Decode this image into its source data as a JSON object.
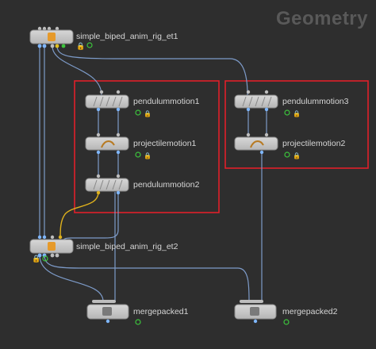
{
  "network_context": "Geometry",
  "nodes": {
    "rig_et1": {
      "name": "simple_biped_anim_rig_et1"
    },
    "pendulummotion1": {
      "name": "pendulummotion1"
    },
    "projectilemotion1": {
      "name": "projectilemotion1"
    },
    "pendulummotion2": {
      "name": "pendulummotion2"
    },
    "pendulummotion3": {
      "name": "pendulummotion3"
    },
    "projectilemotion2": {
      "name": "projectilemotion2"
    },
    "rig_et2": {
      "name": "simple_biped_anim_rig_et2"
    },
    "mergepacked1": {
      "name": "mergepacked1"
    },
    "mergepacked2": {
      "name": "mergepacked2"
    }
  },
  "colors": {
    "background": "#2e2e2e",
    "node_fill": "#c9c9c9",
    "wire": "#7d9bc9",
    "wire_selected": "#e0b21c",
    "group_box": "#e0202a",
    "flag_ok": "#3cc43c",
    "flag_lock": "#d04040",
    "title": "#595959"
  },
  "network_boxes": [
    {
      "id": "box1",
      "contains": [
        "pendulummotion1",
        "projectilemotion1",
        "pendulummotion2"
      ]
    },
    {
      "id": "box2",
      "contains": [
        "pendulummotion3",
        "projectilemotion2"
      ]
    }
  ]
}
